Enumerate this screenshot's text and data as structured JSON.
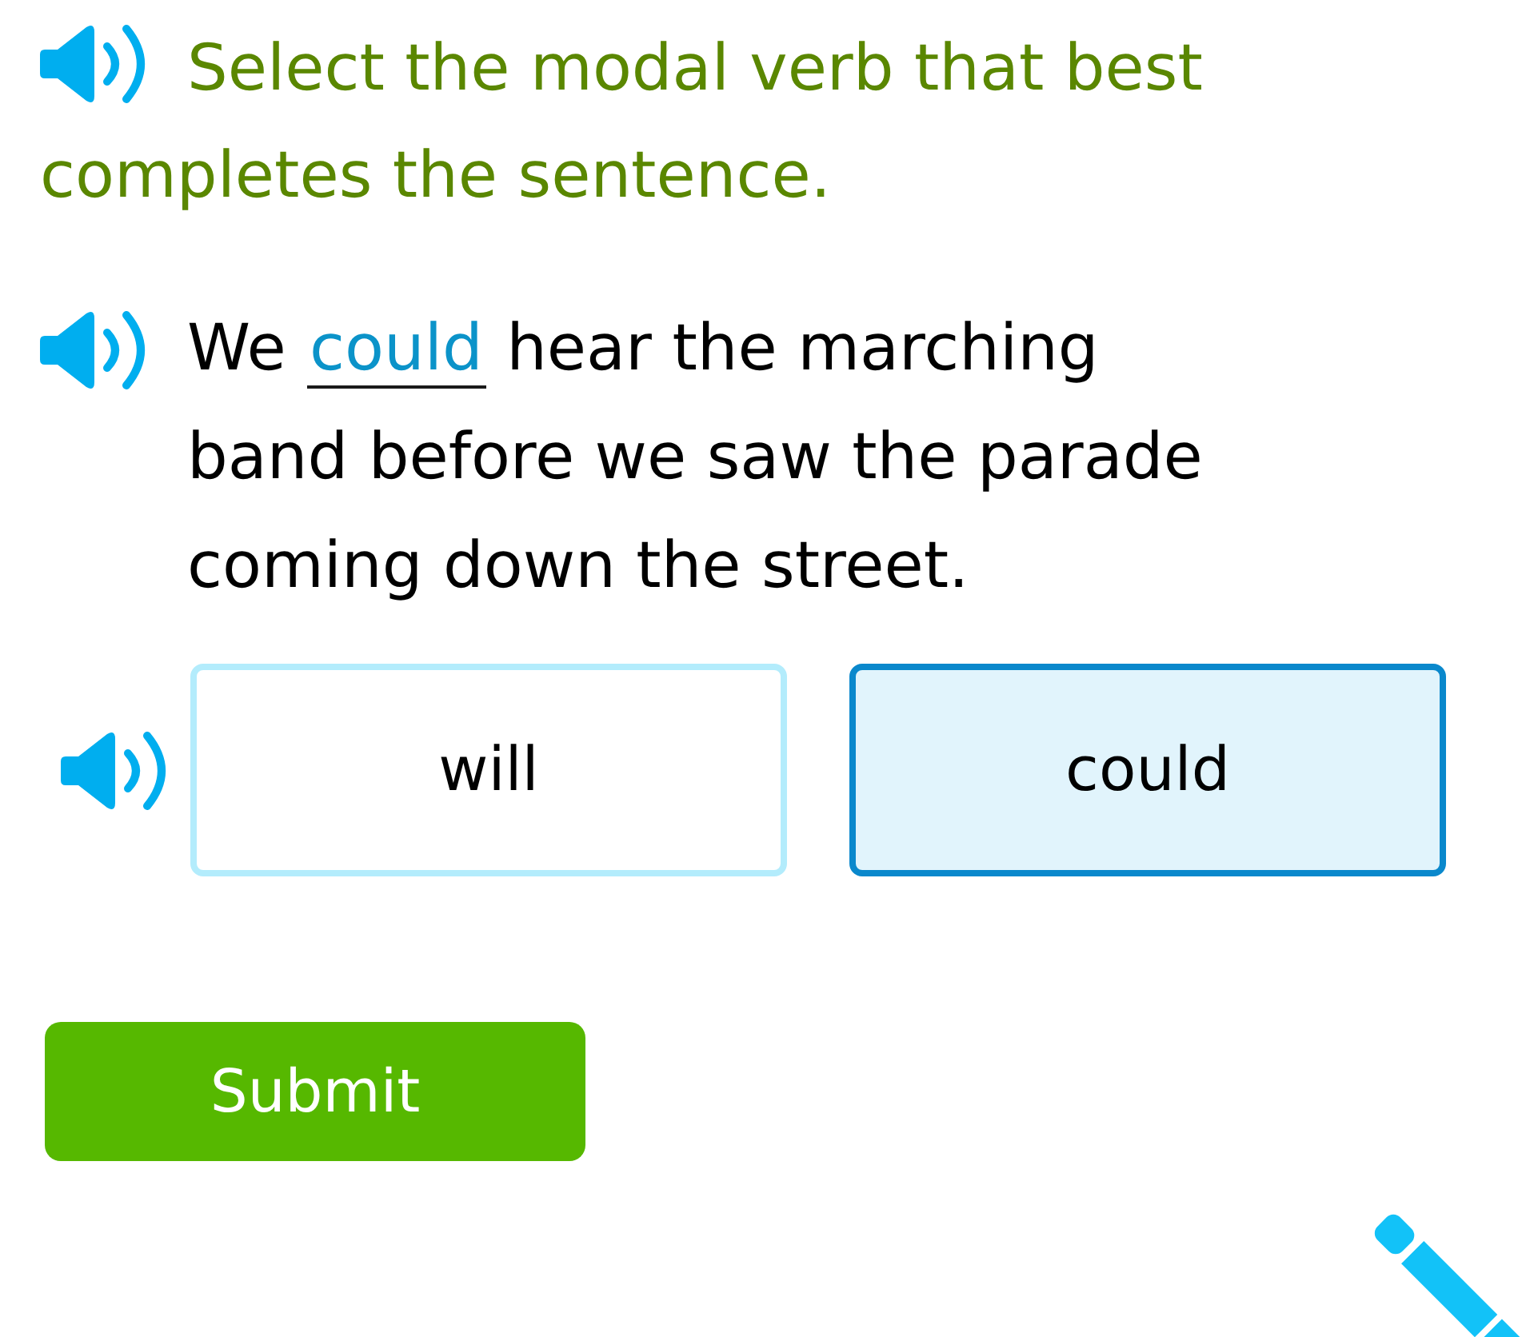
{
  "instruction": {
    "text": "Select the modal verb that best completes the sentence."
  },
  "sentence": {
    "before": "We",
    "blank": "could",
    "after": "hear the marching band before we saw the parade coming down the street."
  },
  "choices": [
    {
      "label": "will",
      "selected": false
    },
    {
      "label": "could",
      "selected": true
    }
  ],
  "submit_button": {
    "label": "Submit"
  }
}
